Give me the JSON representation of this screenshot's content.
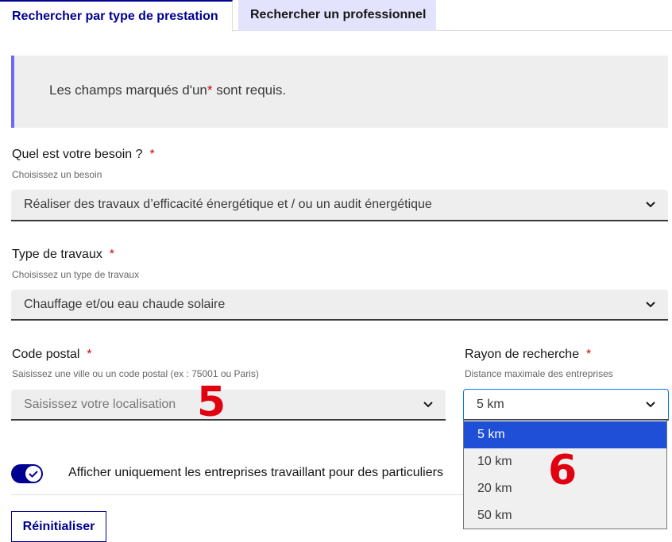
{
  "tabs": [
    {
      "label": "Rechercher par type de prestation",
      "active": true
    },
    {
      "label": "Rechercher un professionnel",
      "active": false
    }
  ],
  "notice": {
    "before": "Les champs marqués d'un",
    "asterisk": "*",
    "after": "sont requis."
  },
  "need": {
    "label": "Quel est votre besoin ?",
    "required": "*",
    "hint": "Choisissez un besoin",
    "value": "Réaliser des travaux d’efficacité énergétique et / ou un audit énergétique"
  },
  "work_type": {
    "label": "Type de travaux",
    "required": "*",
    "hint": "Choisissez un type de travaux",
    "value": "Chauffage et/ou eau chaude solaire"
  },
  "postal_code": {
    "label": "Code postal",
    "required": "*",
    "hint": "Saisissez une ville ou un code postal (ex : 75001 ou Paris)",
    "placeholder": "Saisissez votre localisation"
  },
  "radius": {
    "label": "Rayon de recherche",
    "required": "*",
    "hint": "Distance maximale des entreprises",
    "value": "5 km",
    "options": [
      "5 km",
      "10 km",
      "20 km",
      "50 km"
    ],
    "selected_index": 0
  },
  "markers": {
    "postal_marker": "5",
    "radius_marker": "6"
  },
  "toggle": {
    "label": "Afficher uniquement les entreprises travaillant pour des particuliers",
    "checked": true
  },
  "reset_label": "Réinitialiser",
  "colors": {
    "primary": "#000091",
    "required": "#ce0500",
    "marker": "#e1000f",
    "option_highlight": "#1e4fd6"
  }
}
